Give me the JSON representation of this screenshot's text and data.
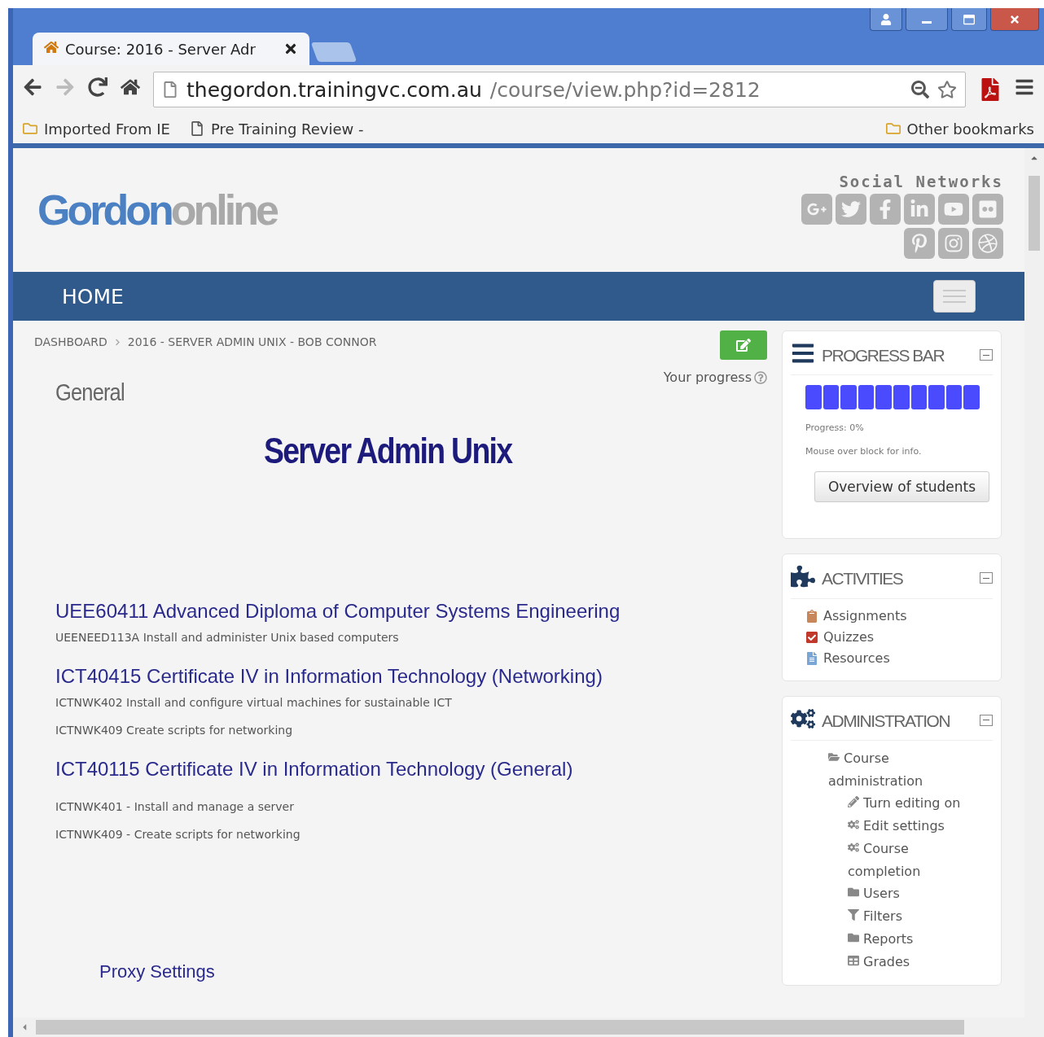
{
  "browser": {
    "tab": {
      "title": "Course: 2016 - Server Adr",
      "selected": true
    },
    "address": {
      "host": "thegordon.trainingvc.com.au",
      "path": "/course/view.php?id=2812"
    },
    "bookmarks": [
      {
        "label": "Imported From IE",
        "kind": "folder"
      },
      {
        "label": "Pre Training Review -",
        "kind": "page"
      }
    ],
    "other_bookmarks": "Other bookmarks"
  },
  "header": {
    "logo_main": "Gordon",
    "logo_tail": "online",
    "social_title": "Social Networks"
  },
  "nav": {
    "items": [
      "HOME"
    ]
  },
  "breadcrumb": [
    "DASHBOARD",
    "2016 - SERVER ADMIN UNIX - BOB CONNOR"
  ],
  "your_progress": "Your progress",
  "section_name": "General",
  "course_title": "Server Admin Unix",
  "qualifications": [
    {
      "title": "UEE60411  Advanced Diploma of Computer Systems Engineering",
      "units": [
        "UEENEED113A Install and administer Unix based computers"
      ]
    },
    {
      "title": "ICT40415 Certificate IV in Information Technology (Networking)",
      "units": [
        "ICTNWK402 Install and configure virtual machines for sustainable ICT",
        "ICTNWK409 Create scripts for networking"
      ]
    },
    {
      "title": "ICT40115 Certificate IV in Information Technology (General)",
      "units": [
        "ICTNWK401 - Install and manage a server",
        "ICTNWK409 - Create scripts for networking"
      ]
    }
  ],
  "proxy_link": "Proxy Settings",
  "progress_block": {
    "title": "PROGRESS BAR",
    "blocks": [
      {
        "done": false
      },
      {
        "done": false
      },
      {
        "done": false
      },
      {
        "done": false
      },
      {
        "done": false
      },
      {
        "done": false
      },
      {
        "done": false
      },
      {
        "done": false
      },
      {
        "done": false
      },
      {
        "done": false
      }
    ],
    "progress": "Progress: 0%",
    "hint": "Mouse over block for info.",
    "button": "Overview of students"
  },
  "activities_block": {
    "title": "ACTIVITIES",
    "items": [
      "Assignments",
      "Quizzes",
      "Resources"
    ]
  },
  "admin_block": {
    "title": "ADMINISTRATION",
    "tree": [
      {
        "label": "Course administration",
        "expanded": true,
        "children": [
          {
            "label": "Turn editing on"
          },
          {
            "label": "Edit settings"
          },
          {
            "label": "Course completion"
          },
          {
            "label": "Users"
          },
          {
            "label": "Filters"
          },
          {
            "label": "Reports"
          },
          {
            "label": "Grades"
          }
        ]
      }
    ]
  }
}
